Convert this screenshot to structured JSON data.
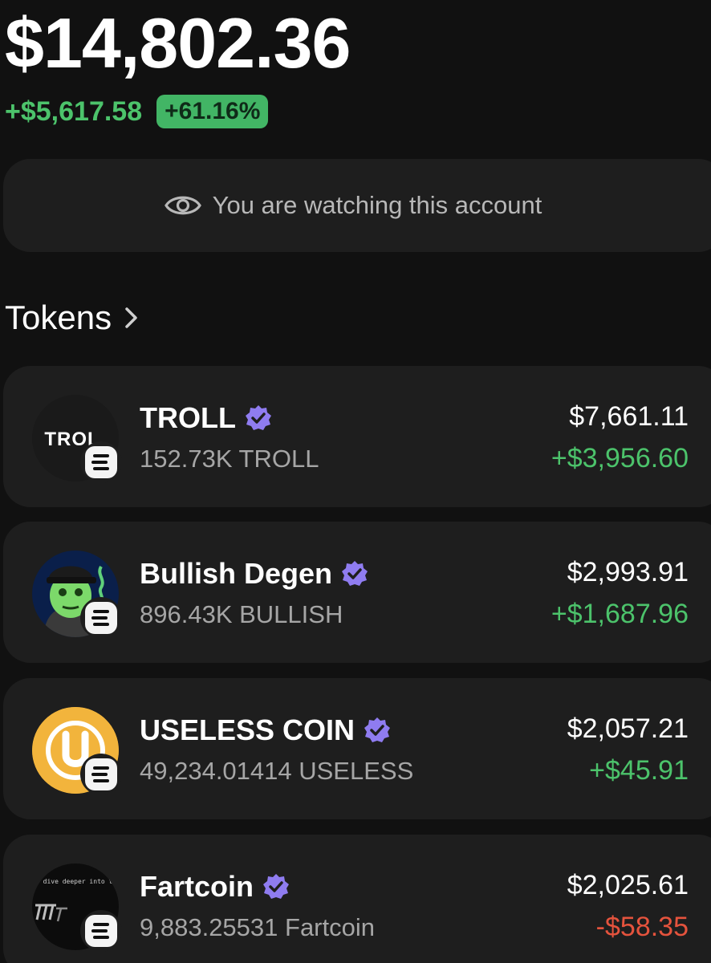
{
  "portfolio": {
    "balance": "$14,802.36",
    "change_abs": "+$5,617.58",
    "change_pct": "+61.16%",
    "accent_green": "#4cc36b"
  },
  "watch_banner": {
    "icon": "eye-icon",
    "text": "You are watching this account"
  },
  "tokens_section": {
    "title": "Tokens",
    "chevron_icon": "chevron-right-icon"
  },
  "tokens": [
    {
      "name": "TROLL",
      "logo_text": "TROL",
      "amount": "152.73K TROLL",
      "value": "$7,661.11",
      "pnl": "+$3,956.60",
      "pnl_color": "#4cc36b",
      "verified": true
    },
    {
      "name": "Bullish Degen",
      "amount": "896.43K BULLISH",
      "value": "$2,993.91",
      "pnl": "+$1,687.96",
      "pnl_color": "#4cc36b",
      "verified": true
    },
    {
      "name": "USELESS COIN",
      "amount": "49,234.01414 USELESS",
      "value": "$2,057.21",
      "pnl": "+$45.91",
      "pnl_color": "#4cc36b",
      "verified": true
    },
    {
      "name": "Fartcoin",
      "logo_text": ". dive deeper into this",
      "amount": "9,883.25531 Fartcoin",
      "value": "$2,025.61",
      "pnl": "-$58.35",
      "pnl_color": "#e5533d",
      "verified": true
    }
  ]
}
